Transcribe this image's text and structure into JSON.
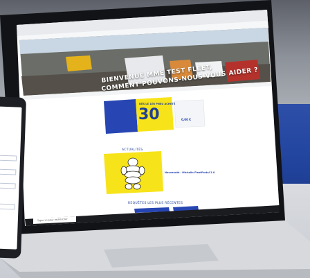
{
  "banner": {
    "line1": "BIENVENUE MME TEST FLEET,",
    "line2": "COMMENT POUVONS-NOUS VOUS AIDER ?"
  },
  "promo": {
    "headline": "DÈS LE 1ER PNEU ACHETÉ",
    "amount": "30",
    "right_amount": "0,00 €"
  },
  "news": {
    "section": "ACTUALITÉS",
    "title": "Nouveauté : Michelin FleetPortal 2.0"
  },
  "requests": {
    "section": "REQUÊTES LES PLUS RÉCENTES"
  },
  "taskbar": {
    "search_placeholder": "Taper ici pour rechercher"
  },
  "colors": {
    "brand_blue": "#27509b",
    "brand_yellow": "#f7e31a"
  }
}
